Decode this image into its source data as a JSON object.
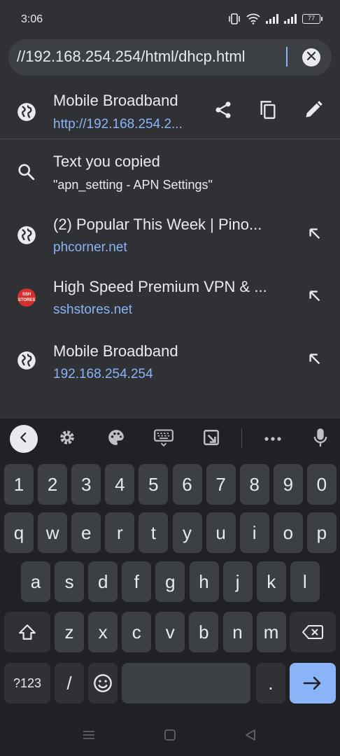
{
  "status": {
    "time": "3:06",
    "battery": "77",
    "icons": [
      "vibrate-icon",
      "wifi-icon",
      "signal-icon",
      "signal-icon"
    ]
  },
  "omnibox": {
    "text": "//192.168.254.254/html/dhcp.html",
    "clear_icon": "close-icon"
  },
  "current_page": {
    "title": "Mobile Broadband",
    "url": "http://192.168.254.2...",
    "icon": "globe-icon",
    "actions": [
      "share-icon",
      "copy-icon",
      "edit-icon"
    ]
  },
  "suggestions": [
    {
      "icon": "search-icon",
      "title": "Text you copied",
      "subtitle": "\"apn_setting - APN Settings\"",
      "has_arrow": false
    },
    {
      "icon": "globe-icon",
      "title": "(2) Popular This Week | Pino...",
      "subtitle": "phcorner.net",
      "has_arrow": true
    },
    {
      "icon": "sshstores-favicon",
      "title": "High Speed Premium VPN & ...",
      "subtitle": "sshstores.net",
      "has_arrow": true
    },
    {
      "icon": "globe-icon",
      "title": "Mobile Broadband",
      "subtitle": "192.168.254.254",
      "has_arrow": true
    }
  ],
  "favicon_text": "SSH STORES",
  "keyboard": {
    "toolbar": [
      "back-icon",
      "settings-icon",
      "palette-icon",
      "keyboard-icon",
      "clipboard-icon",
      "more-icon",
      "microphone-icon"
    ],
    "row_numbers": [
      "1",
      "2",
      "3",
      "4",
      "5",
      "6",
      "7",
      "8",
      "9",
      "0"
    ],
    "row1": [
      "q",
      "w",
      "e",
      "r",
      "t",
      "y",
      "u",
      "i",
      "o",
      "p"
    ],
    "row2": [
      "a",
      "s",
      "d",
      "f",
      "g",
      "h",
      "j",
      "k",
      "l"
    ],
    "row3": [
      "z",
      "x",
      "c",
      "v",
      "b",
      "n",
      "m"
    ],
    "sym_label": "?123",
    "slash": "/",
    "period": ".",
    "enter_icon": "arrow-right-icon",
    "accent": "#8ab4f8"
  },
  "nav": [
    "menu-icon",
    "home-icon",
    "back-icon"
  ]
}
